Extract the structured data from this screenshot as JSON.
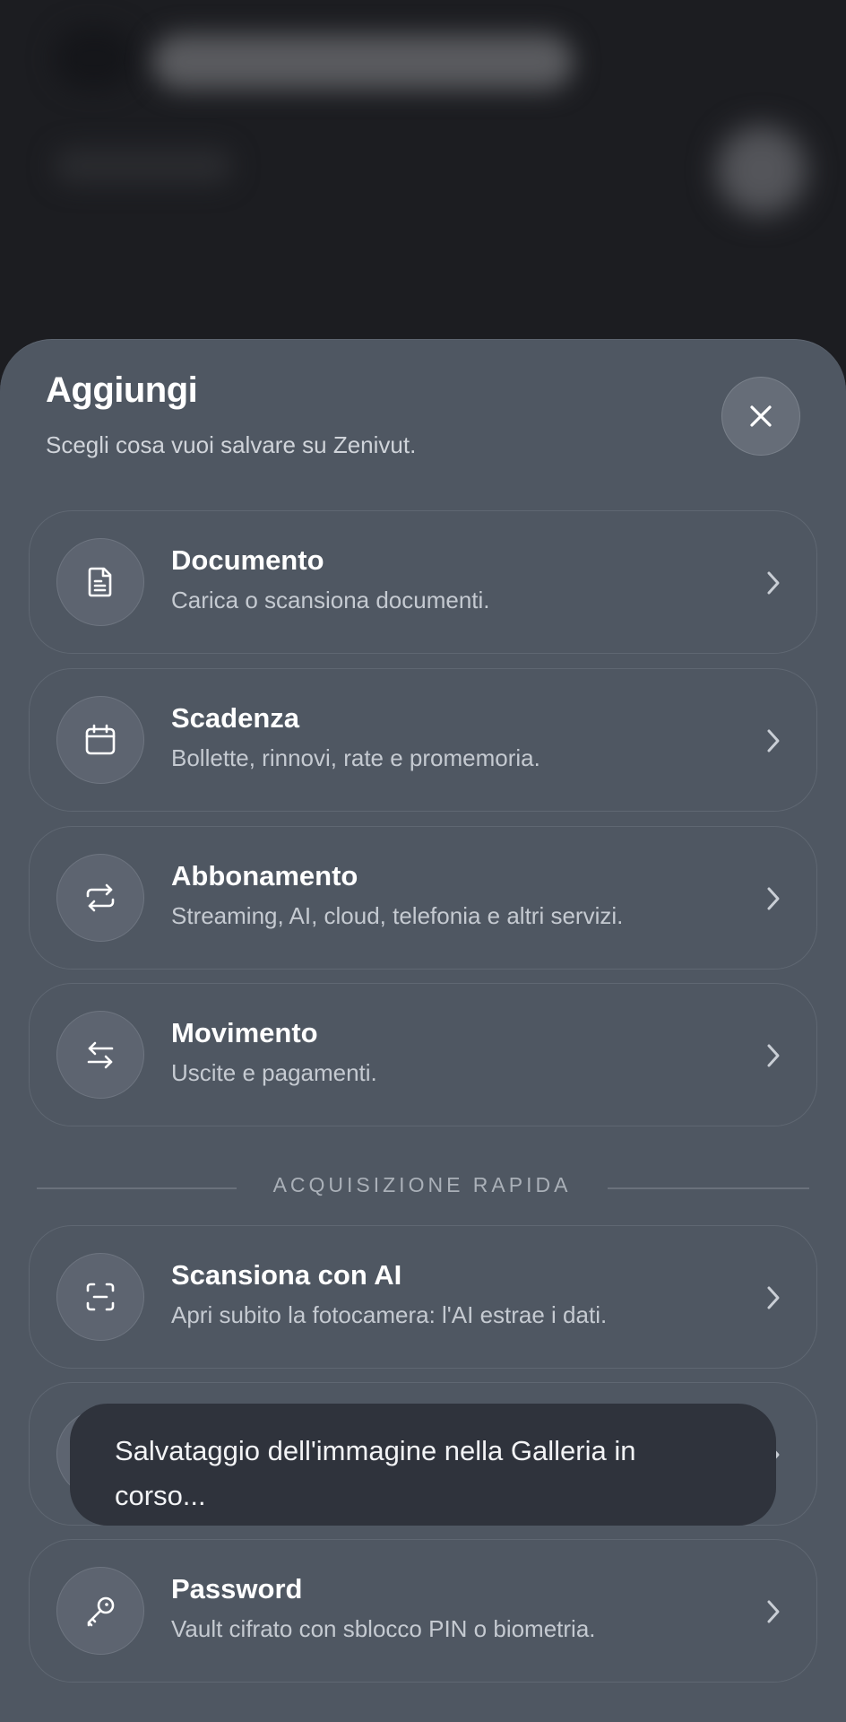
{
  "sheet": {
    "title": "Aggiungi",
    "subtitle": "Scegli cosa vuoi salvare su Zenivut."
  },
  "options": [
    {
      "id": "documento",
      "icon": "document-icon",
      "title": "Documento",
      "description": "Carica o scansiona documenti."
    },
    {
      "id": "scadenza",
      "icon": "calendar-icon",
      "title": "Scadenza",
      "description": "Bollette, rinnovi, rate e promemoria."
    },
    {
      "id": "abbonamento",
      "icon": "repeat-icon",
      "title": "Abbonamento",
      "description": "Streaming, AI, cloud, telefonia e altri servizi."
    },
    {
      "id": "movimento",
      "icon": "transfer-arrows-icon",
      "title": "Movimento",
      "description": "Uscite e pagamenti."
    }
  ],
  "quick_section": {
    "label": "ACQUISIZIONE RAPIDA",
    "items": [
      {
        "id": "scansiona",
        "icon": "scan-icon",
        "title": "Scansiona con AI",
        "description": "Apri subito la fotocamera: l'AI estrae i dati."
      },
      {
        "id": "password",
        "icon": "key-icon",
        "title": "Password",
        "description": "Vault cifrato con sblocco PIN o biometria."
      }
    ]
  },
  "toast": {
    "line1": "Salvataggio dell'immagine nella Galleria in",
    "line2": "corso..."
  }
}
